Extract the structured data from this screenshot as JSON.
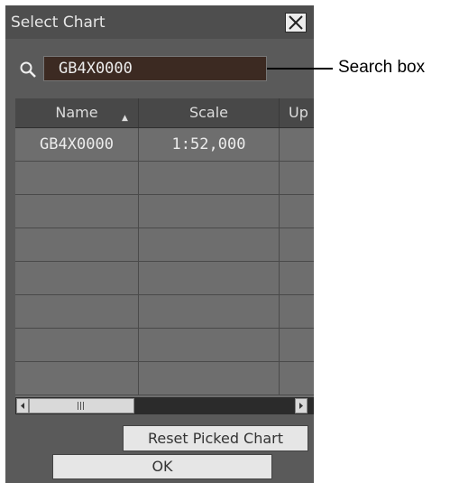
{
  "dialog": {
    "title": "Select Chart",
    "search": {
      "value": "GB4X0000"
    },
    "columns": [
      {
        "label": "Name",
        "sorted": "ascending"
      },
      {
        "label": "Scale"
      },
      {
        "label": "Up"
      }
    ],
    "rows": [
      [
        "GB4X0000",
        "1:52,000",
        ""
      ],
      [
        "",
        "",
        ""
      ],
      [
        "",
        "",
        ""
      ],
      [
        "",
        "",
        ""
      ],
      [
        "",
        "",
        ""
      ],
      [
        "",
        "",
        ""
      ],
      [
        "",
        "",
        ""
      ],
      [
        "",
        "",
        ""
      ]
    ],
    "reset_button_label": "Reset Picked Chart",
    "ok_button_label": "OK"
  },
  "annotation": {
    "label": "Search box"
  },
  "icons": {
    "search": "search-icon",
    "close": "close-icon",
    "sort": "sort-ascending-icon"
  },
  "colors": {
    "dialog_bg": "#5a5a5a",
    "search_bg": "#3c2a22",
    "row_bg": "#6e6e6e"
  }
}
